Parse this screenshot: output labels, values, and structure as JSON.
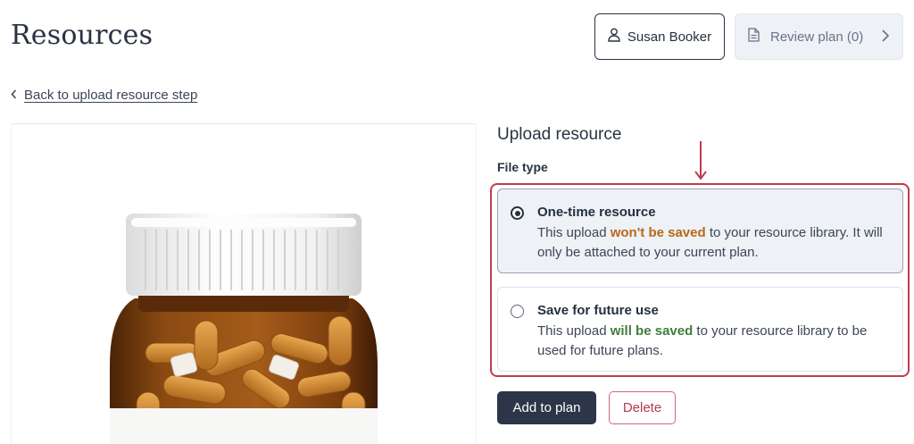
{
  "header": {
    "title": "Resources",
    "user_name": "Susan Booker",
    "review_label": "Review plan (0)"
  },
  "back_link": {
    "label": "Back to upload resource step"
  },
  "upload": {
    "heading": "Upload resource",
    "file_type_label": "File type",
    "options": [
      {
        "title": "One-time resource",
        "desc_pre": "This upload ",
        "desc_emph": "won't be saved",
        "desc_post": " to your resource library. It will only be attached to your current plan.",
        "selected": true
      },
      {
        "title": "Save for future use",
        "desc_pre": "This upload ",
        "desc_emph": "will be saved",
        "desc_post": " to your resource library to be used for future plans.",
        "selected": false
      }
    ]
  },
  "actions": {
    "add_label": "Add to plan",
    "delete_label": "Delete"
  },
  "colors": {
    "primary": "#2c3648",
    "highlight_border": "#c13b4e",
    "warning_text": "#b8681a",
    "success_text": "#3f7d3c",
    "selected_option_bg": "#eef1f6"
  },
  "icons": [
    "user-icon",
    "document-icon",
    "chevron-right-icon",
    "chevron-left-icon",
    "arrow-down-icon",
    "pill-bottle-image"
  ]
}
